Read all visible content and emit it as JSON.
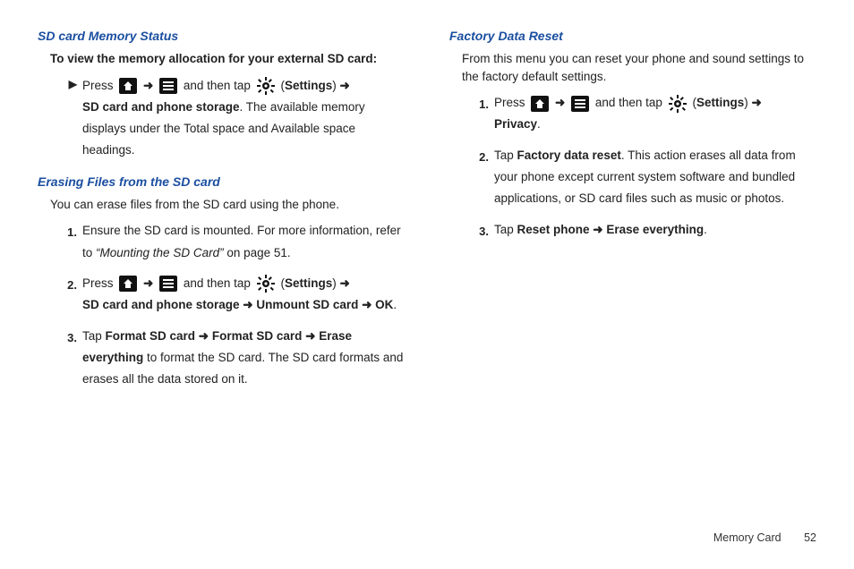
{
  "left": {
    "h1": "SD card Memory Status",
    "intro1": "To view the memory allocation for your external SD card:",
    "s1_press": "Press ",
    "s1_tap": " and then tap ",
    "s1_settings": "Settings",
    "s1_path": "SD card and phone storage",
    "s1_tail": ". The available memory displays under the Total space and Available space headings.",
    "h2": "Erasing Files from the SD card",
    "intro2": "You can erase files from the SD card using the phone.",
    "n1a": "Ensure the SD card is mounted. For more information, refer to ",
    "n1b": "“Mounting the SD Card” ",
    "n1c": " on page 51.",
    "n2_press": "Press ",
    "n2_tap": " and then tap ",
    "n2_settings": "Settings",
    "n2_path": "SD card and phone storage ➜ Unmount SD card ➜ OK",
    "n3a": "Tap ",
    "n3b": "Format SD card ➜ Format SD card ➜  Erase everything",
    "n3c": " to format the SD card. The SD card formats and erases all the data stored on it."
  },
  "right": {
    "h1": "Factory Data Reset",
    "intro1": "From this menu you can reset your phone and sound settings to the factory default settings.",
    "n1_press": "Press ",
    "n1_tap": " and then tap ",
    "n1_settings": "Settings",
    "n1_path": "Privacy",
    "n2a": "Tap ",
    "n2b": "Factory data reset",
    "n2c": ". This action erases all data from your phone except current system software and bundled applications, or SD card files such as music or photos.",
    "n3a": "Tap ",
    "n3b": "Reset phone ➜ Erase everything",
    "n3c": "."
  },
  "arrow": "➜",
  "footer": {
    "section": "Memory Card",
    "page": "52"
  }
}
